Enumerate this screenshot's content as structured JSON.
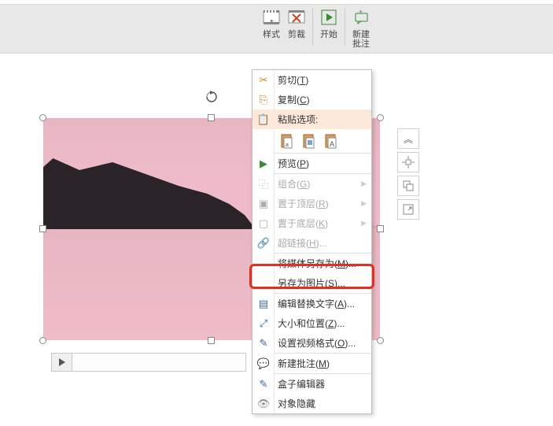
{
  "ribbon": {
    "style": "样式",
    "crop": "剪裁",
    "play": "开始",
    "comment": "新建\n批注"
  },
  "context_menu": {
    "cut": "剪切(T)",
    "copy": "复制(C)",
    "paste_options": "粘贴选项:",
    "preview": "预览(P)",
    "group": "组合(G)",
    "bring_front": "置于顶层(R)",
    "send_back": "置于底层(K)",
    "hyperlink": "超链接(H)...",
    "save_media_as": "将媒体另存为(M)...",
    "save_as_image": "另存为图片(S)...",
    "edit_alt_text": "编辑替换文字(A)...",
    "size_position": "大小和位置(Z)...",
    "video_format": "设置视频格式(O)...",
    "new_comment": "新建批注(M)",
    "box_editor": "盒子编辑器",
    "object_hide": "对象隐藏"
  },
  "side_tools": {
    "collapse": "︽",
    "align": "⊕",
    "arrange": "❐",
    "resize": "⤢"
  }
}
